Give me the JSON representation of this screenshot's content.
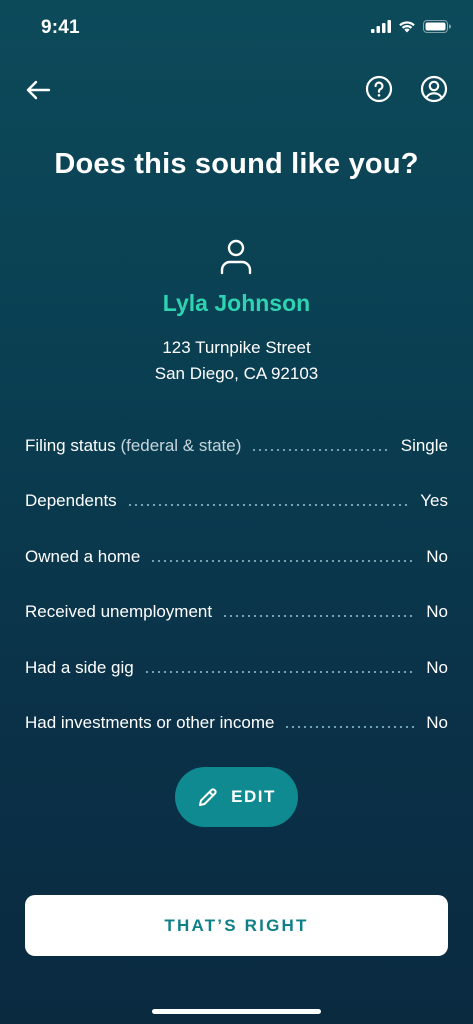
{
  "status_bar": {
    "time": "9:41"
  },
  "nav": {
    "back_icon": "arrow-left-icon",
    "help_icon": "question-circle-icon",
    "profile_icon": "user-circle-icon"
  },
  "title": "Does this sound like you?",
  "profile": {
    "name": "Lyla Johnson",
    "address_line1": "123 Turnpike Street",
    "address_line2": "San Diego, CA 92103"
  },
  "summary": [
    {
      "label": "Filing status",
      "label_note": "(federal & state)",
      "value": "Single"
    },
    {
      "label": "Dependents",
      "label_note": "",
      "value": "Yes"
    },
    {
      "label": "Owned a home",
      "label_note": "",
      "value": "No"
    },
    {
      "label": "Received unemployment",
      "label_note": "",
      "value": "No"
    },
    {
      "label": "Had a side gig",
      "label_note": "",
      "value": "No"
    },
    {
      "label": "Had investments or other income",
      "label_note": "",
      "value": "No"
    }
  ],
  "edit_button": {
    "label": "EDIT",
    "icon": "pencil-icon"
  },
  "confirm_button": {
    "label": "THAT’S RIGHT"
  },
  "colors": {
    "accent": "#2ed3b2",
    "edit_bg": "#0f8a91",
    "confirm_text": "#0f7f87",
    "bg_top": "#0c4a5a",
    "bg_bottom": "#0a2a40"
  }
}
